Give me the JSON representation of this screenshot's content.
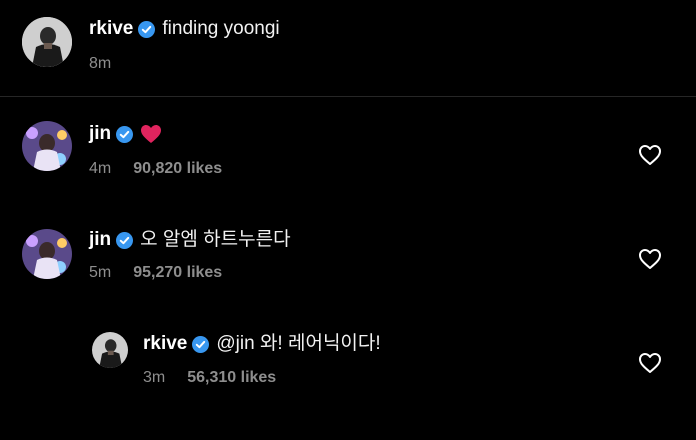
{
  "caption": {
    "username": "rkive",
    "text": "finding yoongi",
    "time": "8m"
  },
  "comments": [
    {
      "username": "jin",
      "text": "",
      "emoji": "red-heart",
      "time": "4m",
      "likes": "90,820 likes"
    },
    {
      "username": "jin",
      "text": "오 알엠 하트누른다",
      "time": "5m",
      "likes": "95,270 likes"
    }
  ],
  "reply": {
    "username": "rkive",
    "text": "@jin 와! 레어닉이다!",
    "time": "3m",
    "likes": "56,310 likes"
  },
  "icons": {
    "verified": "verified-badge-icon",
    "like": "heart-outline-icon",
    "emoji": "red-heart-emoji"
  },
  "colors": {
    "background": "#000000",
    "verified": "#3897f0",
    "meta": "#8e8e8e",
    "emoji_heart": "#e0245e"
  }
}
